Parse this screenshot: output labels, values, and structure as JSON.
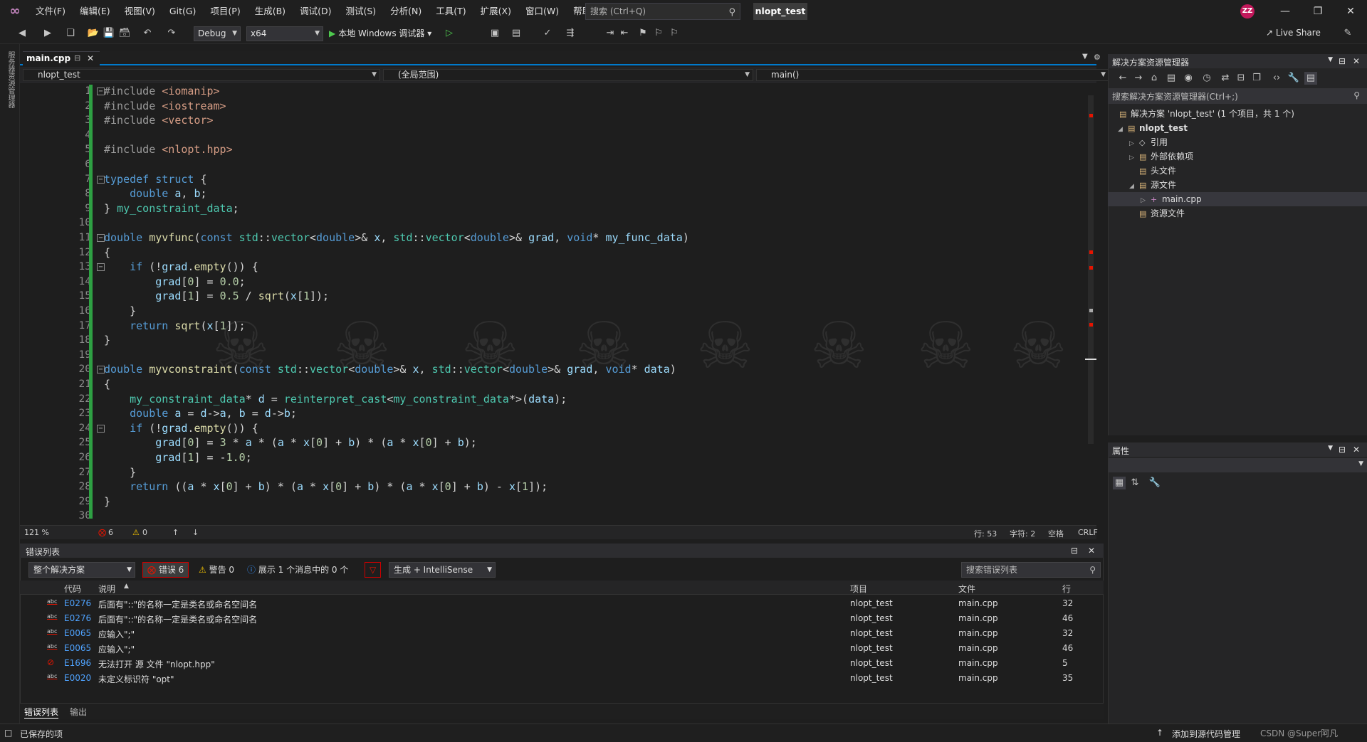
{
  "titlebar": {
    "menu": [
      "文件(F)",
      "编辑(E)",
      "视图(V)",
      "Git(G)",
      "项目(P)",
      "生成(B)",
      "调试(D)",
      "测试(S)",
      "分析(N)",
      "工具(T)",
      "扩展(X)",
      "窗口(W)",
      "帮助(H)"
    ],
    "search_placeholder": "搜索 (Ctrl+Q)",
    "solution_name": "nlopt_test",
    "avatar": "ZZ"
  },
  "toolbar": {
    "config": "Debug",
    "platform": "x64",
    "run_label": "本地 Windows 调试器",
    "live_share": "Live Share"
  },
  "left_rail_label": "服务器资源管理器",
  "editor": {
    "tab_title": "main.cpp",
    "nav_project": "nlopt_test",
    "nav_scope": "(全局范围)",
    "nav_member": "main()",
    "line_numbers": [
      "1",
      "2",
      "3",
      "4",
      "5",
      "6",
      "7",
      "8",
      "9",
      "10",
      "11",
      "12",
      "13",
      "14",
      "15",
      "16",
      "17",
      "18",
      "19",
      "20",
      "21",
      "22",
      "23",
      "24",
      "25",
      "26",
      "27",
      "28",
      "29",
      "30"
    ],
    "lines": [
      "#include <iomanip>",
      "#include <iostream>",
      "#include <vector>",
      "",
      "#include <nlopt.hpp>",
      "",
      "typedef struct {",
      "    double a, b;",
      "} my_constraint_data;",
      "",
      "double myvfunc(const std::vector<double>& x, std::vector<double>& grad, void* my_func_data)",
      "{",
      "    if (!grad.empty()) {",
      "        grad[0] = 0.0;",
      "        grad[1] = 0.5 / sqrt(x[1]);",
      "    }",
      "    return sqrt(x[1]);",
      "}",
      "",
      "double myvconstraint(const std::vector<double>& x, std::vector<double>& grad, void* data)",
      "{",
      "    my_constraint_data* d = reinterpret_cast<my_constraint_data*>(data);",
      "    double a = d->a, b = d->b;",
      "    if (!grad.empty()) {",
      "        grad[0] = 3 * a * (a * x[0] + b) * (a * x[0] + b);",
      "        grad[1] = -1.0;",
      "    }",
      "    return ((a * x[0] + b) * (a * x[0] + b) * (a * x[0] + b) - x[1]);",
      "}",
      ""
    ],
    "zoom": "121 %",
    "error_count": "6",
    "warning_count": "0",
    "line_info": "行: 53",
    "char_info": "字符: 2",
    "whitespace": "空格",
    "line_ending": "CRLF"
  },
  "error_list": {
    "title": "错误列表",
    "scope": "整个解决方案",
    "errors_chip": "错误 6",
    "warnings_chip": "警告 0",
    "messages_chip": "展示 1 个消息中的 0 个",
    "build_filter": "生成 + IntelliSense",
    "search_placeholder": "搜索错误列表",
    "columns": {
      "code": "代码",
      "desc": "说明",
      "project": "项目",
      "file": "文件",
      "line": "行"
    },
    "rows": [
      {
        "code": "E0276",
        "desc": "后面有\"::\"的名称一定是类名或命名空间名",
        "project": "nlopt_test",
        "file": "main.cpp",
        "line": "32",
        "icon": "abc-icon"
      },
      {
        "code": "E0276",
        "desc": "后面有\"::\"的名称一定是类名或命名空间名",
        "project": "nlopt_test",
        "file": "main.cpp",
        "line": "46",
        "icon": "abc-icon"
      },
      {
        "code": "E0065",
        "desc": "应输入\";\"",
        "project": "nlopt_test",
        "file": "main.cpp",
        "line": "32",
        "icon": "abc-icon"
      },
      {
        "code": "E0065",
        "desc": "应输入\";\"",
        "project": "nlopt_test",
        "file": "main.cpp",
        "line": "46",
        "icon": "abc-icon"
      },
      {
        "code": "E1696",
        "desc": "无法打开 源 文件 \"nlopt.hpp\"",
        "project": "nlopt_test",
        "file": "main.cpp",
        "line": "5",
        "icon": "error-circle-icon"
      },
      {
        "code": "E0020",
        "desc": "未定义标识符 \"opt\"",
        "project": "nlopt_test",
        "file": "main.cpp",
        "line": "35",
        "icon": "abc-icon"
      }
    ],
    "bottom_tabs": [
      "错误列表",
      "输出"
    ]
  },
  "solution_explorer": {
    "title": "解决方案资源管理器",
    "search_placeholder": "搜索解决方案资源管理器(Ctrl+;)",
    "solution": "解决方案 'nlopt_test' (1 个项目，共 1 个)",
    "project": "nlopt_test",
    "items": [
      "引用",
      "外部依赖项",
      "头文件",
      "源文件",
      "main.cpp",
      "资源文件"
    ]
  },
  "properties": {
    "title": "属性"
  },
  "statusbar": {
    "saved": "已保存的项",
    "source_control": "添加到源代码管理",
    "watermark": "CSDN @Super阿凡"
  },
  "colors": {
    "accent": "#007acc",
    "keyword": "#569cd6",
    "type": "#4ec9b0",
    "function": "#dcdcaa",
    "string": "#d69d85",
    "change_bar": "#2ea043",
    "error": "#e51400"
  }
}
